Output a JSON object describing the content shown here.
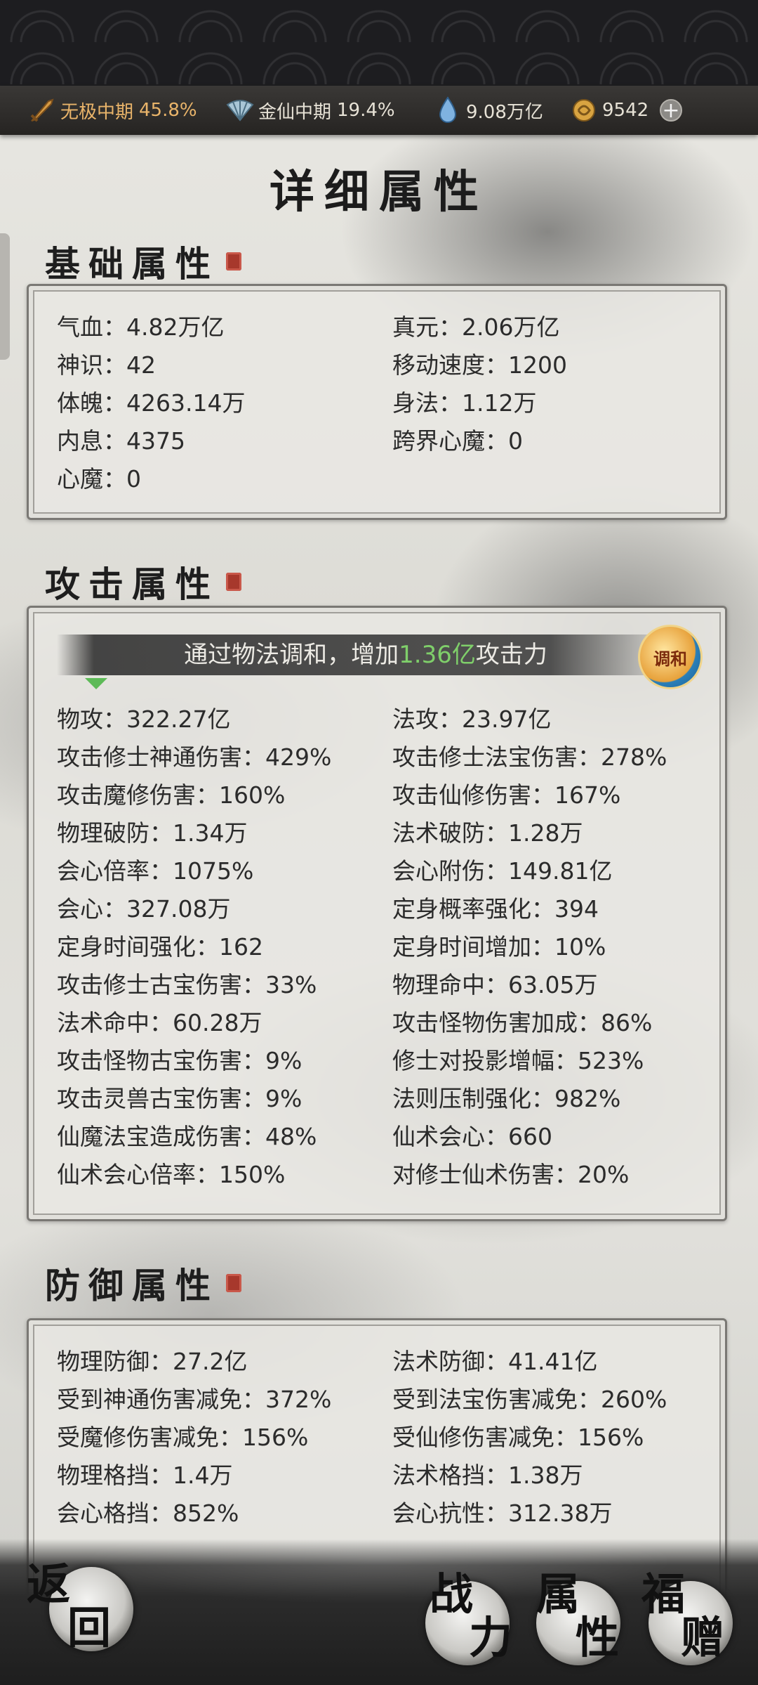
{
  "status_bar": {
    "realm1": {
      "name": "无极中期",
      "percent": "45.8%"
    },
    "realm2": {
      "name": "金仙中期",
      "percent": "19.4%"
    },
    "crystal": "9.08万亿",
    "coins": "9542"
  },
  "page_title": "详细属性",
  "basic": {
    "title": "基础属性",
    "stats": [
      "气血：4.82万亿",
      "真元：2.06万亿",
      "神识：42",
      "移动速度：1200",
      "体魄：4263.14万",
      "身法：1.12万",
      "内息：4375",
      "跨界心魔：0",
      "心魔：0"
    ]
  },
  "attack": {
    "title": "攻击属性",
    "banner": {
      "prefix": "通过物法调和，增加",
      "value": "1.36亿",
      "suffix": "攻击力"
    },
    "harmony_icon_label": "调和",
    "stats": [
      "物攻：322.27亿",
      "法攻：23.97亿",
      "攻击修士神通伤害：429%",
      "攻击修士法宝伤害：278%",
      "攻击魔修伤害：160%",
      "攻击仙修伤害：167%",
      "物理破防：1.34万",
      "法术破防：1.28万",
      "会心倍率：1075%",
      "会心附伤：149.81亿",
      "会心：327.08万",
      "定身概率强化：394",
      "定身时间强化：162",
      "定身时间增加：10%",
      "攻击修士古宝伤害：33%",
      "物理命中：63.05万",
      "法术命中：60.28万",
      "攻击怪物伤害加成：86%",
      "攻击怪物古宝伤害：9%",
      "修士对投影增幅：523%",
      "攻击灵兽古宝伤害：9%",
      "法则压制强化：982%",
      "仙魔法宝造成伤害：48%",
      "仙术会心：660",
      "仙术会心倍率：150%",
      "对修士仙术伤害：20%"
    ]
  },
  "defense": {
    "title": "防御属性",
    "stats": [
      "物理防御：27.2亿",
      "法术防御：41.41亿",
      "受到神通伤害减免：372%",
      "受到法宝伤害减免：260%",
      "受魔修伤害减免：156%",
      "受仙修伤害减免：156%",
      "物理格挡：1.4万",
      "法术格挡：1.38万",
      "会心格挡：852%",
      "会心抗性：312.38万"
    ]
  },
  "bottom_nav": {
    "back": [
      "返",
      "回"
    ],
    "power": [
      "战",
      "力"
    ],
    "attributes": [
      "属",
      "性"
    ],
    "gift": [
      "福",
      "赠"
    ]
  }
}
